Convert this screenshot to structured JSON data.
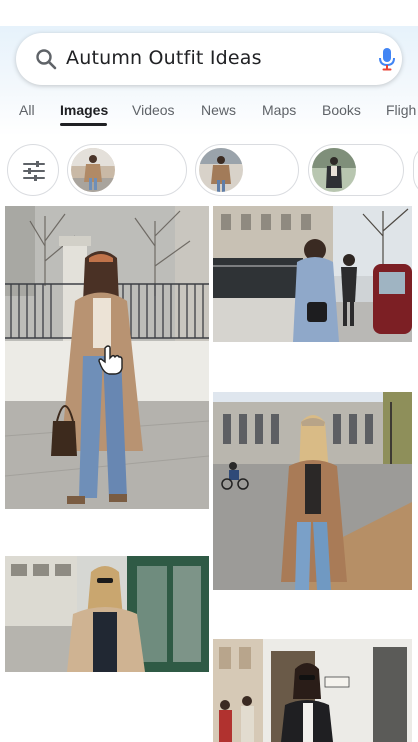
{
  "search": {
    "query": "Autumn Outfit Ideas"
  },
  "tabs": [
    {
      "label": "All",
      "active": false
    },
    {
      "label": "Images",
      "active": true
    },
    {
      "label": "Videos",
      "active": false
    },
    {
      "label": "News",
      "active": false
    },
    {
      "label": "Maps",
      "active": false
    },
    {
      "label": "Books",
      "active": false
    },
    {
      "label": "Fligh",
      "active": false
    }
  ],
  "icons": {
    "search": "search-icon",
    "mic": "microphone-icon",
    "filter": "tune-sliders-icon",
    "pointer": "hand-pointer-icon"
  },
  "colors": {
    "accent_text": "#202124",
    "muted_text": "#5f6368",
    "mic_blue": "#4285f4",
    "mic_red": "#ea4335",
    "coat_camel": "#b89372",
    "jeans_blue": "#6f8fb8",
    "header_tint": "#e6f2fb"
  }
}
